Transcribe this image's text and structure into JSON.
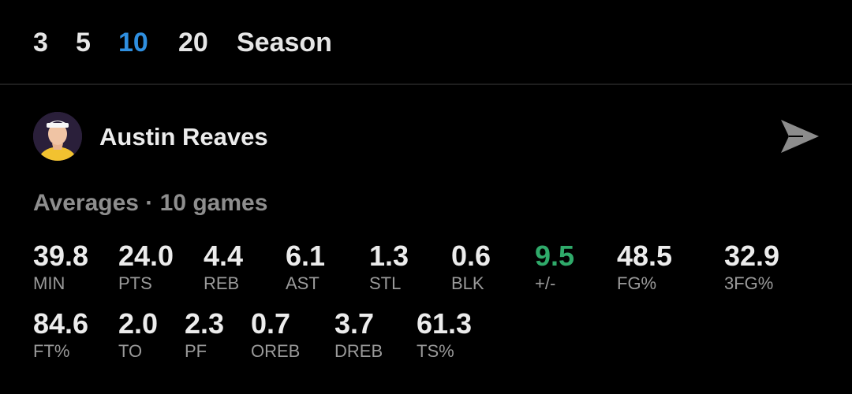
{
  "range_tabs": [
    {
      "label": "3",
      "active": false
    },
    {
      "label": "5",
      "active": false
    },
    {
      "label": "10",
      "active": true
    },
    {
      "label": "20",
      "active": false
    },
    {
      "label": "Season",
      "active": false
    }
  ],
  "player": {
    "name": "Austin Reaves",
    "avatar_icon": "player-headshot"
  },
  "averages_label": "Averages · 10 games",
  "stats_row1": [
    {
      "value": "39.8",
      "label": "MIN"
    },
    {
      "value": "24.0",
      "label": "PTS"
    },
    {
      "value": "4.4",
      "label": "REB"
    },
    {
      "value": "6.1",
      "label": "AST"
    },
    {
      "value": "1.3",
      "label": "STL"
    },
    {
      "value": "0.6",
      "label": "BLK"
    },
    {
      "value": "9.5",
      "label": "+/-"
    },
    {
      "value": "48.5",
      "label": "FG%"
    },
    {
      "value": "32.9",
      "label": "3FG%"
    }
  ],
  "stats_row2": [
    {
      "value": "84.6",
      "label": "FT%"
    },
    {
      "value": "2.0",
      "label": "TO"
    },
    {
      "value": "2.3",
      "label": "PF"
    },
    {
      "value": "0.7",
      "label": "OREB"
    },
    {
      "value": "3.7",
      "label": "DREB"
    },
    {
      "value": "61.3",
      "label": "TS%"
    }
  ],
  "colors": {
    "background": "#000000",
    "active_tab": "#2f8fe0",
    "positive": "#2faa6a",
    "muted": "#8e8e8e"
  },
  "icons": {
    "share": "send-arrow-icon"
  }
}
